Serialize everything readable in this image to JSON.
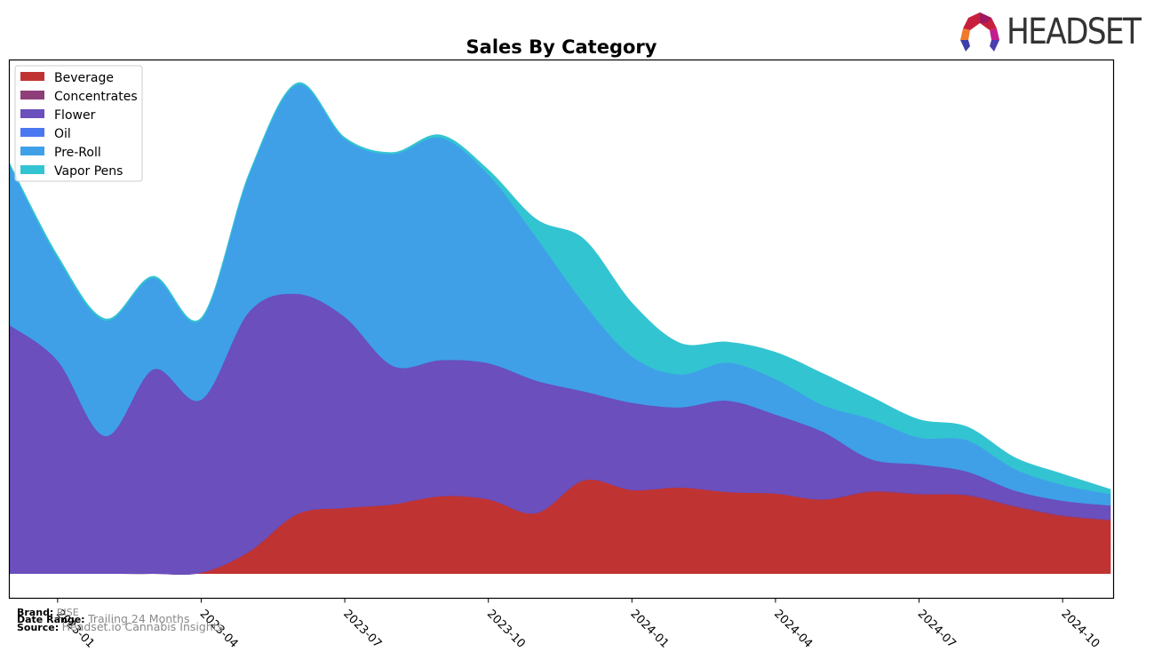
{
  "brand_logo": {
    "text": "HEADSET"
  },
  "footer": {
    "brand_label": "Brand:",
    "brand_value": "RISE",
    "date_range_label": "Date Range:",
    "date_range_value": "Trailing 24 Months",
    "source_label": "Source:",
    "source_value": "Headset.io Cannabis Insights"
  },
  "chart_data": {
    "type": "area",
    "stacked": true,
    "smooth": true,
    "title": "Sales By Category",
    "xlabel": "",
    "ylabel": "",
    "y_units": "relative sales index (no y-axis ticks shown)",
    "ylim": [
      -4.8,
      100
    ],
    "grid": false,
    "legend_position": "top-left",
    "x": [
      "2022-12",
      "2023-01",
      "2023-02",
      "2023-03",
      "2023-04",
      "2023-05",
      "2023-06",
      "2023-07",
      "2023-08",
      "2023-09",
      "2023-10",
      "2023-11",
      "2023-12",
      "2024-01",
      "2024-02",
      "2024-03",
      "2024-04",
      "2024-05",
      "2024-06",
      "2024-07",
      "2024-08",
      "2024-09",
      "2024-10",
      "2024-11"
    ],
    "x_tick_labels": [
      "2023-01",
      "2023-04",
      "2023-07",
      "2023-10",
      "2024-01",
      "2024-04",
      "2024-07",
      "2024-10"
    ],
    "series": [
      {
        "name": "Beverage",
        "color": "#c03333",
        "values": [
          0.0,
          0.0,
          0.0,
          0.0,
          0.2,
          4.3,
          11.6,
          12.8,
          13.5,
          15.1,
          14.5,
          11.8,
          18.2,
          16.3,
          16.8,
          15.9,
          15.6,
          14.4,
          15.9,
          15.4,
          15.2,
          13.0,
          11.2,
          10.4
        ]
      },
      {
        "name": "Concentrates",
        "color": "#8e3e78",
        "values": [
          0.0,
          0.0,
          0.0,
          0.0,
          0.0,
          0.0,
          0.0,
          0.0,
          0.0,
          0.0,
          0.0,
          0.0,
          0.0,
          0.0,
          0.0,
          0.0,
          0.0,
          0.1,
          0.2,
          0.2,
          0.2,
          0.2,
          0.2,
          0.1
        ]
      },
      {
        "name": "Flower",
        "color": "#6a4fbd",
        "values": [
          48.4,
          41.5,
          26.8,
          39.8,
          33.7,
          46.7,
          42.9,
          37.2,
          27.0,
          26.5,
          26.5,
          25.8,
          17.3,
          17.0,
          15.6,
          17.8,
          15.4,
          13.1,
          6.2,
          5.7,
          4.5,
          3.0,
          2.8,
          2.8
        ]
      },
      {
        "name": "Oil",
        "color": "#4a78f0",
        "values": [
          0.0,
          0.0,
          0.0,
          0.0,
          0.0,
          0.0,
          0.0,
          0.0,
          0.0,
          0.0,
          0.0,
          0.0,
          0.0,
          0.0,
          0.0,
          0.0,
          0.0,
          0.0,
          0.0,
          0.0,
          0.0,
          0.0,
          0.0,
          0.0
        ]
      },
      {
        "name": "Pre-Roll",
        "color": "#3fa0e8",
        "values": [
          31.1,
          19.9,
          22.5,
          17.8,
          15.6,
          26.6,
          40.7,
          34.6,
          41.2,
          43.3,
          36.7,
          27.9,
          17.1,
          9.0,
          6.4,
          7.4,
          6.9,
          5.2,
          7.8,
          5.2,
          6.1,
          4.2,
          3.1,
          2.2
        ]
      },
      {
        "name": "Vapor Pens",
        "color": "#33c4d2",
        "values": [
          0.3,
          0.5,
          0.3,
          0.3,
          0.3,
          0.3,
          0.3,
          0.3,
          0.3,
          0.5,
          0.9,
          3.5,
          12.5,
          10.4,
          6.1,
          4.0,
          5.2,
          6.1,
          4.3,
          3.5,
          2.6,
          2.2,
          2.1,
          0.9
        ]
      }
    ]
  }
}
